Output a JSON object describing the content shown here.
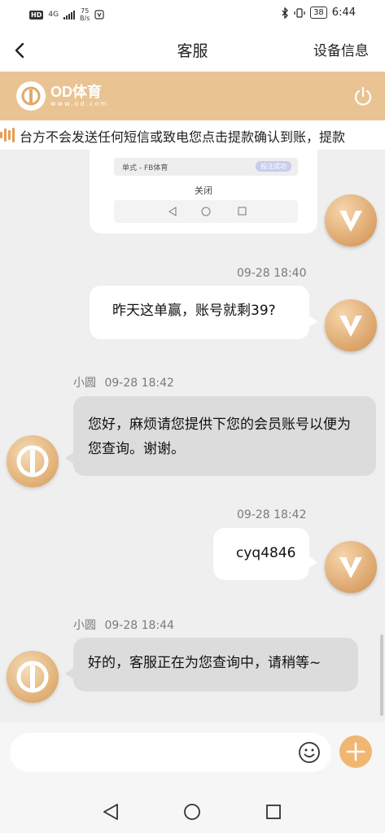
{
  "status_bar": {
    "hd": "HD",
    "network": "4G",
    "speed_value": "75",
    "speed_unit": "B/s",
    "battery": "38",
    "time": "6:44"
  },
  "header": {
    "title": "客服",
    "right_action": "设备信息"
  },
  "brand": {
    "name": "OD体育",
    "url": "www.od.com",
    "color": "#eac393"
  },
  "notice": {
    "text": "台方不会发送任何短信或致电您点击提款确认到账，提款"
  },
  "image_message": {
    "row_left": "单式 - FB体育",
    "row_right": "投注成功",
    "close_label": "关闭"
  },
  "messages": [
    {
      "direction": "out",
      "time": "09-28 18:40",
      "text": "昨天这单赢，账号就剩39?"
    },
    {
      "direction": "in",
      "sender": "小圆",
      "time": "09-28 18:42",
      "text": "您好，麻烦请您提供下您的会员账号以便为您查询。谢谢。"
    },
    {
      "direction": "out",
      "time": "09-28 18:42",
      "text": "cyq4846"
    },
    {
      "direction": "in",
      "sender": "小圆",
      "time": "09-28 18:44",
      "text": "好的，客服正在为您查询中，请稍等~"
    }
  ],
  "input": {
    "placeholder": ""
  },
  "colors": {
    "accent": "#f0b773",
    "incoming_bubble": "#dcdcdc",
    "outgoing_bubble": "#ffffff",
    "background": "#efefef"
  },
  "icons": {
    "back": "chevron-left-icon",
    "power": "power-icon",
    "emoji": "smiley-icon",
    "plus": "plus-icon",
    "sys_back": "triangle-back-icon",
    "sys_home": "circle-home-icon",
    "sys_recent": "square-recent-icon"
  }
}
